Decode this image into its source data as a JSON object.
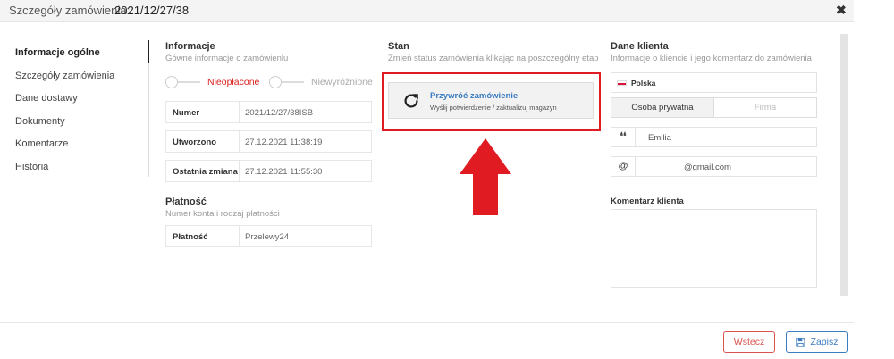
{
  "header": {
    "title_label": "Szczegóły zamówienia:",
    "order_number": "2021/12/27/38",
    "close_glyph": "✖"
  },
  "sidebar": {
    "items": [
      {
        "label": "Informacje ogólne",
        "active": true
      },
      {
        "label": "Szczegóły zamówienia",
        "active": false
      },
      {
        "label": "Dane dostawy",
        "active": false
      },
      {
        "label": "Dokumenty",
        "active": false
      },
      {
        "label": "Komentarze",
        "active": false
      },
      {
        "label": "Historia",
        "active": false
      }
    ]
  },
  "info": {
    "title": "Informacje",
    "subtitle": "Gówne informacje o zamówienlu",
    "payment_status": "Nieopłacone",
    "highlight_status": "Niewyróżnione",
    "rows": [
      {
        "key": "Numer",
        "value": "2021/12/27/38ISB"
      },
      {
        "key": "Utworzono",
        "value": "27.12.2021 11:38:19"
      },
      {
        "key": "Ostatnia zmiana",
        "value": "27.12.2021 11:55:30"
      }
    ]
  },
  "payment": {
    "title": "Płatność",
    "subtitle": "Numer konta i rodzaj płatności",
    "key": "Płatność",
    "value": "Przelewy24"
  },
  "status": {
    "title": "Stan",
    "subtitle": "Zmień status zamówienia klikając na poszczególny etap",
    "restore_title": "Przywróć zamówienie",
    "restore_sub": "Wyślij potwierdzenie / zaktualizuj magazyn",
    "icon": "refresh-icon"
  },
  "client": {
    "title": "Dane klienta",
    "subtitle": "Informacje o kliencie i jego komentarz do zamówienia",
    "country": "Polska",
    "type_person": "Osoba prywatna",
    "type_company": "Firma",
    "name_prefix": "❛❛",
    "name": "Emilia",
    "email_prefix": "@",
    "email": "@gmail.com",
    "comment_label": "Komentarz klienta",
    "comment": ""
  },
  "footer": {
    "cancel": "Wstecz",
    "save": "Zapisz"
  },
  "colors": {
    "accent_red": "#e01b22",
    "link_blue": "#3b7bc0",
    "status_red": "#d9211e"
  }
}
